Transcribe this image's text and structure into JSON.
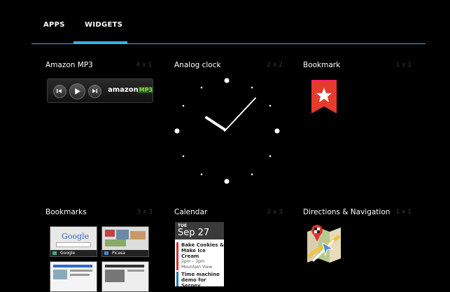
{
  "tabs": [
    {
      "label": "APPS",
      "selected": false
    },
    {
      "label": "WIDGETS",
      "selected": true
    }
  ],
  "widgets": [
    {
      "title": "Amazon MP3",
      "size": "4 x 1",
      "logo_text": "amazon",
      "logo_suffix": "MP3"
    },
    {
      "title": "Analog clock",
      "size": "2 x 2"
    },
    {
      "title": "Bookmark",
      "size": "1 x 1"
    },
    {
      "title": "Bookmarks",
      "size": "3 x 3",
      "thumbs": [
        {
          "label": "Google",
          "page_text": "Google"
        },
        {
          "label": "Picasa"
        },
        {
          "label": ""
        },
        {
          "label": ""
        }
      ]
    },
    {
      "title": "Calendar",
      "size": "2 x 3",
      "day": "TUE",
      "date": "Sep 27",
      "events": [
        {
          "title": "Bake Cookies & Make Ice Cream",
          "time": "2pm – 3pm",
          "place": "Mountain View"
        },
        {
          "title": "Time machine demo for Sergey"
        }
      ]
    },
    {
      "title": "Directions & Navigation",
      "size": "1 x 1"
    }
  ],
  "colors": {
    "accent": "#33b5e5",
    "background": "#000000",
    "bookmark": "#e53b2c"
  }
}
